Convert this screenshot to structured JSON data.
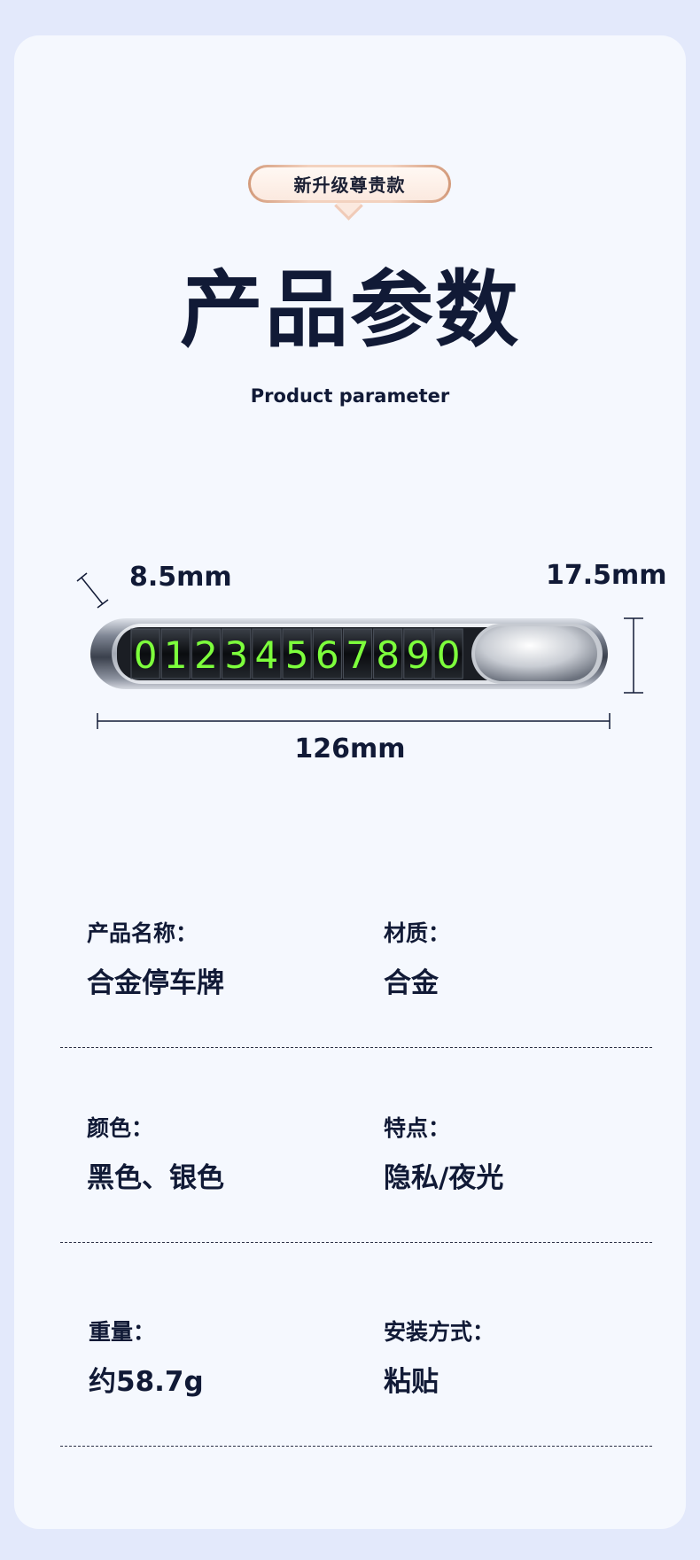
{
  "badge": {
    "text": "新升级尊贵款"
  },
  "title": "产品参数",
  "subtitle": "Product parameter",
  "dimensions": {
    "thickness": "8.5mm",
    "height": "17.5mm",
    "length": "126mm"
  },
  "plate": {
    "digits": [
      "0",
      "1",
      "2",
      "3",
      "4",
      "5",
      "6",
      "7",
      "8",
      "9",
      "0"
    ],
    "digit_color": "#7dff3c"
  },
  "specs": [
    {
      "label": "产品名称：",
      "value": "合金停车牌"
    },
    {
      "label": "材质：",
      "value": "合金"
    },
    {
      "label": "颜色：",
      "value": "黑色、银色"
    },
    {
      "label": "特点：",
      "value": "隐私/夜光"
    },
    {
      "label": "重量：",
      "value": "约58.7g"
    },
    {
      "label": "安装方式：",
      "value": "粘贴"
    }
  ],
  "colors": {
    "background": "#e3e9fb",
    "card": "#f5f8fe",
    "text": "#111a36",
    "badge_border": "#d39a7a"
  }
}
